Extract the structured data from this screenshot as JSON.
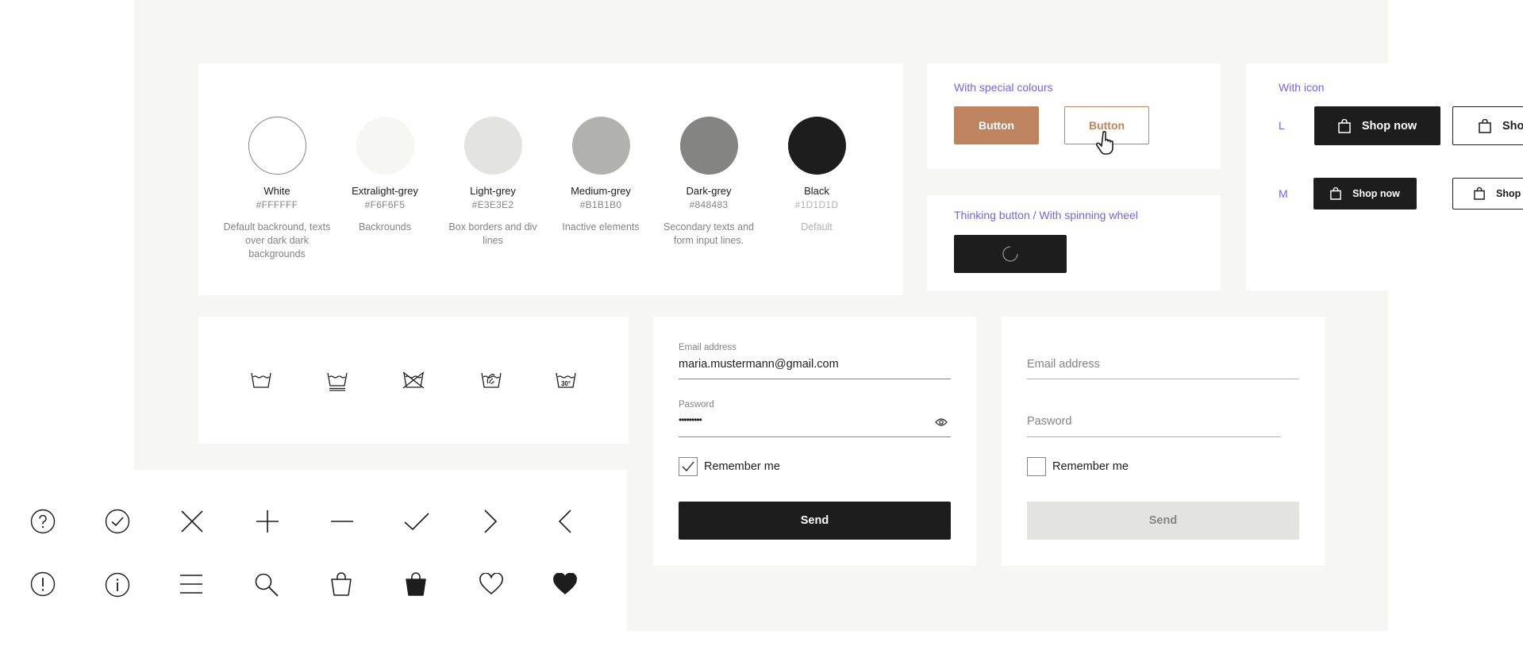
{
  "palette": {
    "colors": [
      {
        "name": "White",
        "hex": "#FFFFFF",
        "desc": "Default backround, texts over dark dark backgrounds"
      },
      {
        "name": "Extralight-grey",
        "hex": "#F6F6F5",
        "desc": "Backrounds"
      },
      {
        "name": "Light-grey",
        "hex": "#E3E3E2",
        "desc": "Box borders and div lines"
      },
      {
        "name": "Medium-grey",
        "hex": "#B1B1B0",
        "desc": "Inactive elements"
      },
      {
        "name": "Dark-grey",
        "hex": "#848483",
        "desc": "Secondary texts and form input lines."
      },
      {
        "name": "Black",
        "hex": "#1D1D1D",
        "desc": "Default"
      }
    ]
  },
  "special_colours": {
    "title": "With special colours",
    "primary_label": "Button",
    "secondary_label": "Button",
    "accent": "#BE8460"
  },
  "thinking": {
    "title": "Thinking button / With spinning wheel"
  },
  "with_icon": {
    "title": "With icon",
    "size_l": "L",
    "size_m": "M",
    "label": "Shop now",
    "cut_label_l": "Sho",
    "cut_label_m": "Shop n"
  },
  "laundry_icons": [
    "wash-icon",
    "wash-gentle-icon",
    "do-not-wash-icon",
    "hand-wash-icon",
    "wash-30-icon"
  ],
  "laundry_wash_temp": "30°",
  "form_filled": {
    "email_label": "Email address",
    "email_value": "maria.mustermann@gmail.com",
    "password_label": "Pasword",
    "password_value": "•••••••••",
    "remember_label": "Remember me",
    "send_label": "Send"
  },
  "form_empty": {
    "email_placeholder": "Email address",
    "password_placeholder": "Pasword",
    "remember_label": "Remember me",
    "send_label": "Send"
  },
  "ui_icons_row1": [
    "question-icon",
    "check-circle-icon",
    "close-icon",
    "plus-icon",
    "minus-icon",
    "checkmark-icon",
    "chevron-right-icon",
    "chevron-left-icon"
  ],
  "ui_icons_row2": [
    "exclamation-icon",
    "info-icon",
    "menu-icon",
    "search-icon",
    "bag-icon",
    "bag-filled-icon",
    "heart-icon",
    "heart-filled-icon"
  ]
}
